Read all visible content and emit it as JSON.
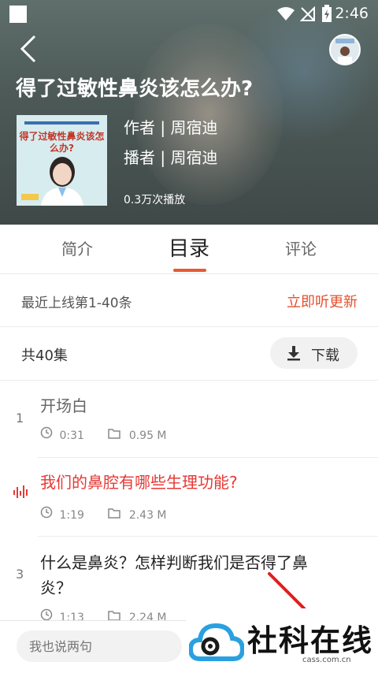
{
  "status_bar": {
    "time": "2:46"
  },
  "header": {
    "title": "得了过敏性鼻炎该怎么办?",
    "author": "作者 | 周宿迪",
    "narrator": "播者 | 周宿迪",
    "plays": "0.3万次播放",
    "cover_title": "得了过敏性鼻炎该怎么办?"
  },
  "tabs": [
    {
      "label": "简介"
    },
    {
      "label": "目录"
    },
    {
      "label": "评论"
    }
  ],
  "update_row": {
    "text": "最近上线第1-40条",
    "action": "立即听更新"
  },
  "count_row": {
    "count": "共40集",
    "download_label": "下载"
  },
  "episodes": [
    {
      "number": "1",
      "title": "开场白",
      "duration": "0:31",
      "size": "0.95 M"
    },
    {
      "number": "",
      "title": "我们的鼻腔有哪些生理功能?",
      "duration": "1:19",
      "size": "2.43 M"
    },
    {
      "number": "3",
      "title": "什么是鼻炎？怎样判断我们是否得了鼻炎？",
      "duration": "1:13",
      "size": "2.24 M"
    }
  ],
  "bottom_bar": {
    "comment_placeholder": "我也说两句"
  },
  "watermark": {
    "brand": "社科在线",
    "url": "cass.com.cn"
  },
  "colors": {
    "accent": "#e5502f",
    "playing_title": "#e53935"
  }
}
